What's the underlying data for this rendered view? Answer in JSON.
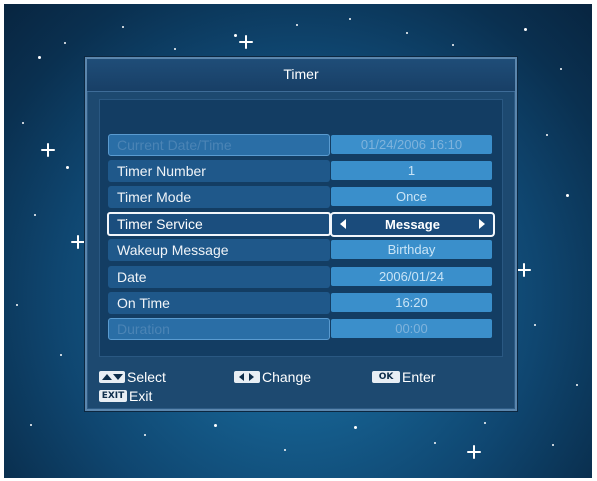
{
  "dialog": {
    "title": "Timer"
  },
  "fields": [
    {
      "label": "Current Date/Time",
      "value": "01/24/2006 16:10",
      "state": "disabled"
    },
    {
      "label": "Timer Number",
      "value": "1",
      "state": "normal"
    },
    {
      "label": "Timer Mode",
      "value": "Once",
      "state": "normal"
    },
    {
      "label": "Timer Service",
      "value": "Message",
      "state": "selected"
    },
    {
      "label": "Wakeup Message",
      "value": "Birthday",
      "state": "normal"
    },
    {
      "label": "Date",
      "value": "2006/01/24",
      "state": "normal"
    },
    {
      "label": "On Time",
      "value": "16:20",
      "state": "normal"
    },
    {
      "label": "Duration",
      "value": "00:00",
      "state": "disabled"
    }
  ],
  "footer": {
    "select_label": "Select",
    "change_label": "Change",
    "ok_key": "OK",
    "enter_label": "Enter",
    "exit_key": "EXIT",
    "exit_label": "Exit"
  },
  "icons": {
    "select": "up-down-arrows-icon",
    "change": "left-right-arrows-icon",
    "value_prev": "left-arrow-icon",
    "value_next": "right-arrow-icon"
  },
  "colors": {
    "dialog_bg": "#1d4970",
    "value_bg": "#3a8fcb",
    "selection_border": "#f2f6fb"
  }
}
